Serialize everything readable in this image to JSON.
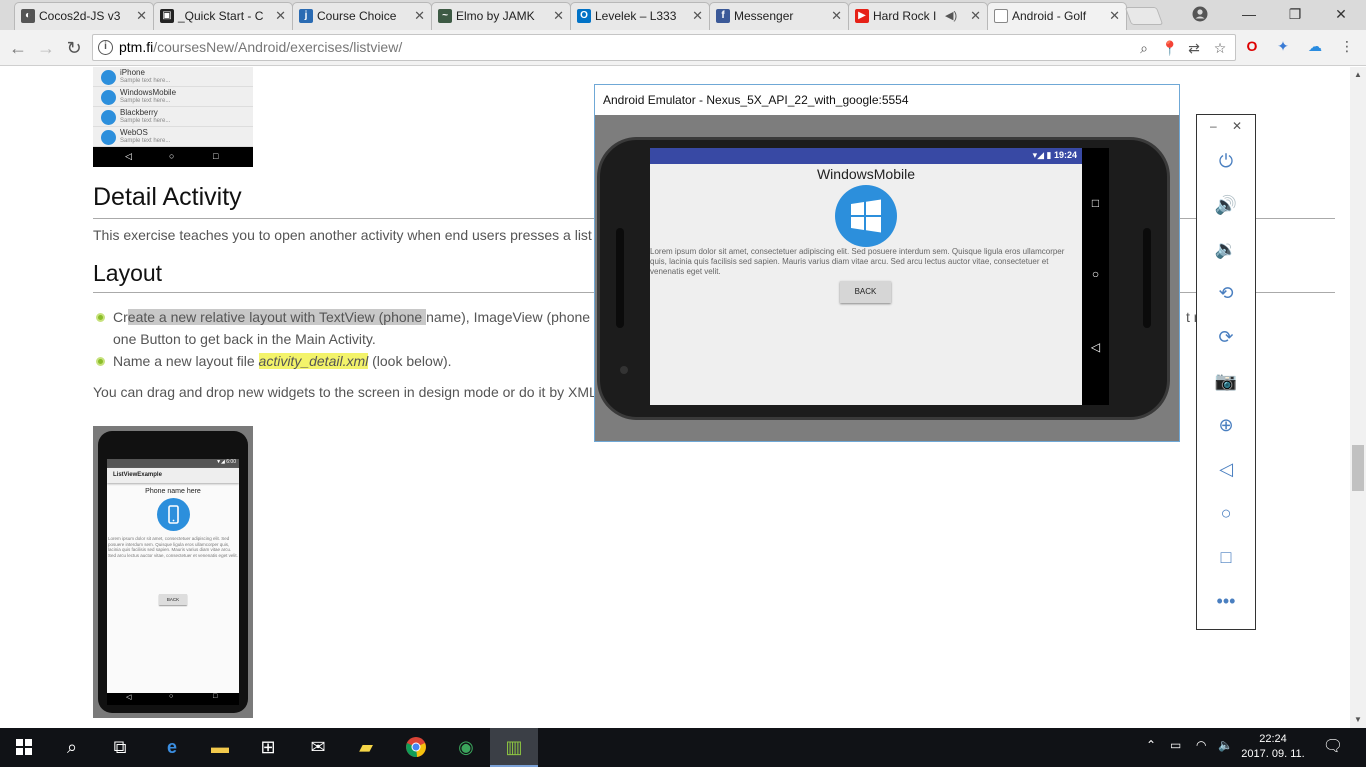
{
  "browser": {
    "tabs": [
      {
        "label": "Cocos2d-JS v3",
        "favicon": "cocos-icon",
        "color": "#555555"
      },
      {
        "label": "_Quick Start - C",
        "favicon": "document-icon",
        "color": "#222222"
      },
      {
        "label": "Course Choice",
        "favicon": "j-icon",
        "color": "#2a6bb3"
      },
      {
        "label": "Elmo by JAMK",
        "favicon": "elmo-icon",
        "color": "#3d5a44"
      },
      {
        "label": "Levelek – L333",
        "favicon": "outlook-icon",
        "color": "#0072c6"
      },
      {
        "label": "Messenger",
        "favicon": "facebook-icon",
        "color": "#3b5998"
      },
      {
        "label": "Hard Rock I",
        "favicon": "youtube-icon",
        "color": "#e62117"
      },
      {
        "label": "Android - Golf",
        "favicon": "page-icon",
        "color": "#888888"
      }
    ],
    "url_host": "ptm.fi",
    "url_path": "/coursesNew/Android/exercises/listview/",
    "tab_close": "✕",
    "window_controls": {
      "minimize": "—",
      "maximize": "❐",
      "close": "✕"
    }
  },
  "page": {
    "list_items": [
      {
        "name": "iPhone",
        "sub": "Sample text here..."
      },
      {
        "name": "WindowsMobile",
        "sub": "Sample text here..."
      },
      {
        "name": "Blackberry",
        "sub": "Sample text here..."
      },
      {
        "name": "WebOS",
        "sub": "Sample text here..."
      }
    ],
    "heading_detail": "Detail Activity",
    "detail_text": "This exercise teaches you to open another activity when end users presses a list v",
    "heading_layout": "Layout",
    "bullet1_pre": "Cr",
    "bullet1_hl": "eate a new relative layout with TextView (phone ",
    "bullet1_post": "name), ImageView (phone im",
    "bullet1_line2": "one Button to get back in the Main Activity.",
    "bullet1_tail": "t n",
    "bullet2_pre": "Name a new layout file ",
    "bullet2_file": "activity_detail.xml",
    "bullet2_post": " (look below).",
    "drag_text": "You can drag and drop new widgets to the screen in design mode or do it by XML c",
    "mock": {
      "status": "▼◢ 6:00",
      "app_title": "ListViewExample",
      "phone_title": "Phone name here",
      "lorem": "Lorem ipsum dolor sit amet, consectetuer adipiscing elit. Sed posuere interdum sem. Quisque ligula eros ullamcorper quis, lacinia quis facilisis sed sapien. Mauris varius diam vitae arcu. Sed arcu lectus auctor vitae, consectetuer et venenatis eget velit.",
      "button": "BACK"
    }
  },
  "emulator": {
    "window_title": "Android Emulator - Nexus_5X_API_22_with_google:5554",
    "status_time": "19:24",
    "screen_title": "WindowsMobile",
    "lorem": "Lorem ipsum dolor sit amet, consectetuer adipiscing elit. Sed posuere interdum sem. Quisque ligula eros ullamcorper quis, lacinia quis facilisis sed sapien. Mauris varius diam vitae arcu. Sed arcu lectus auctor vitae, consectetuer et venenatis eget velit.",
    "button": "BACK",
    "toolbar": {
      "minimize": "–",
      "close": "✕",
      "buttons": [
        "power-icon",
        "volume-up-icon",
        "volume-down-icon",
        "rotate-left-icon",
        "rotate-right-icon",
        "camera-icon",
        "zoom-icon",
        "back-icon",
        "home-icon",
        "overview-icon",
        "more-icon"
      ]
    }
  },
  "taskbar": {
    "time": "22:24",
    "date": "2017. 09. 11."
  },
  "colors": {
    "accent_blue": "#2c8fdc",
    "status_bar": "#3849a4",
    "bullet_green": "#8bbd2a"
  }
}
